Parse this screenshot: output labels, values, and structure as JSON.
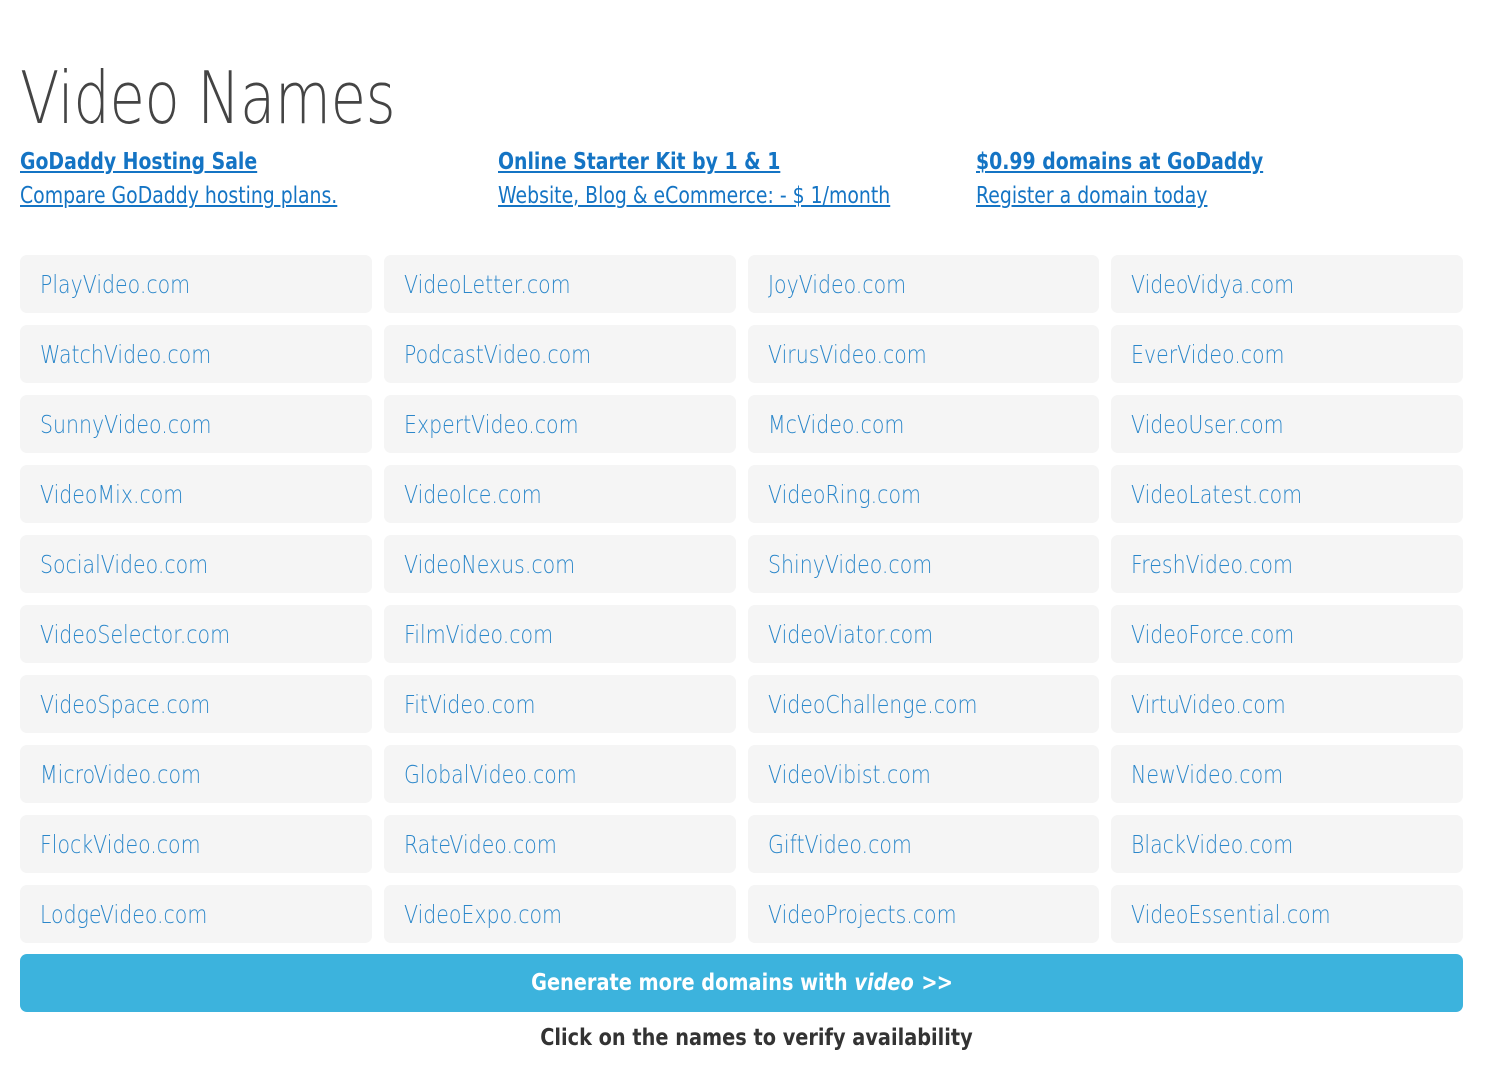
{
  "header": {
    "title": "Video Names"
  },
  "ads": [
    {
      "headline": "GoDaddy Hosting Sale",
      "description": "Compare GoDaddy hosting plans."
    },
    {
      "headline": "Online Starter Kit by 1 & 1",
      "description": "Website, Blog & eCommerce: - $ 1/month"
    },
    {
      "headline": "$0.99 domains at GoDaddy",
      "description": "Register a domain today"
    }
  ],
  "domains": [
    "PlayVideo.com",
    "VideoLetter.com",
    "JoyVideo.com",
    "VideoVidya.com",
    "WatchVideo.com",
    "PodcastVideo.com",
    "VirusVideo.com",
    "EverVideo.com",
    "SunnyVideo.com",
    "ExpertVideo.com",
    "McVideo.com",
    "VideoUser.com",
    "VideoMix.com",
    "VideoIce.com",
    "VideoRing.com",
    "VideoLatest.com",
    "SocialVideo.com",
    "VideoNexus.com",
    "ShinyVideo.com",
    "FreshVideo.com",
    "VideoSelector.com",
    "FilmVideo.com",
    "VideoViator.com",
    "VideoForce.com",
    "VideoSpace.com",
    "FitVideo.com",
    "VideoChallenge.com",
    "VirtuVideo.com",
    "MicroVideo.com",
    "GlobalVideo.com",
    "VideoVibist.com",
    "NewVideo.com",
    "FlockVideo.com",
    "RateVideo.com",
    "GiftVideo.com",
    "BlackVideo.com",
    "LodgeVideo.com",
    "VideoExpo.com",
    "VideoProjects.com",
    "VideoEssential.com"
  ],
  "cta": {
    "text": "Generate more domains with",
    "keyword": "video",
    "chevrons": ">>"
  },
  "footer": {
    "hint": "Click on the names to verify availability"
  },
  "colors": {
    "accent_blue": "#3CB3DD",
    "link_blue": "#1474C4",
    "domain_blue": "#2B87CA",
    "cell_bg": "#F5F5F5",
    "title_gray": "#444444",
    "footer_gray": "#333333"
  }
}
